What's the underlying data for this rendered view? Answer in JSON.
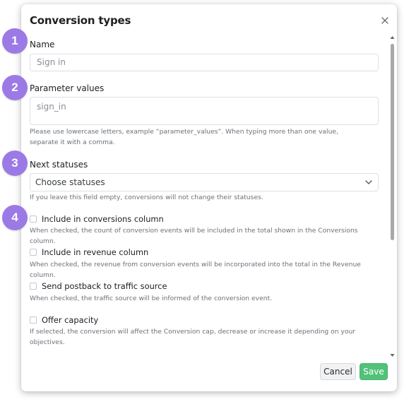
{
  "dialog": {
    "title": "Conversion types",
    "close_icon": "close-icon"
  },
  "name_field": {
    "label": "Name",
    "placeholder": "Sign in"
  },
  "parameter_field": {
    "label": "Parameter values",
    "placeholder": "sign_in",
    "help": "Please use lowercase letters, example “parameter_values”. When typing more than one value, separate it with a comma."
  },
  "next_statuses": {
    "label": "Next statuses",
    "selected": "Choose statuses",
    "help": "If you leave this field empty, conversions will not change their statuses."
  },
  "options": [
    {
      "label": "Include in conversions column",
      "help": "When checked, the count of conversion events will be included in the total shown in the Conversions column.",
      "checked": false
    },
    {
      "label": "Include in revenue column",
      "help": "When checked, the revenue from conversion events will be incorporated into the total in the Revenue column.",
      "checked": false
    },
    {
      "label": "Send postback to traffic source",
      "help": "When checked, the traffic source will be informed of the conversion event.",
      "checked": false
    },
    {
      "label": "Offer capacity",
      "help": "If selected, the conversion will affect the Conversion cap, decrease or increase it depending on your objectives.",
      "checked": false
    }
  ],
  "footer": {
    "cancel_label": "Cancel",
    "save_label": "Save"
  },
  "badges": [
    "1",
    "2",
    "3",
    "4"
  ],
  "colors": {
    "badge": "#9b7ae6",
    "save_button": "#52c27a",
    "cancel_button": "#f1f2f4"
  }
}
